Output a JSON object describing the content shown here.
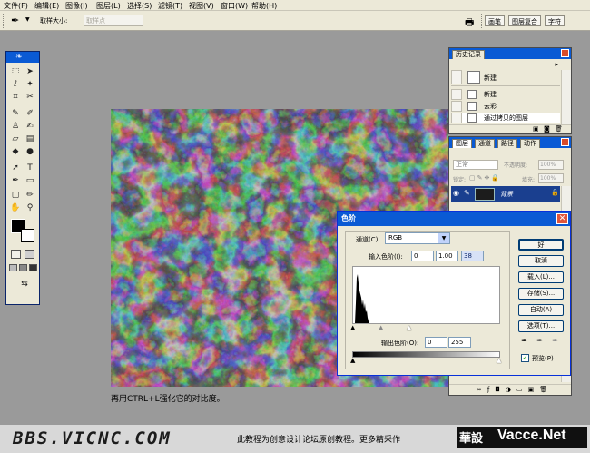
{
  "menu": [
    "文件(F)",
    "编辑(E)",
    "图像(I)",
    "图层(L)",
    "选择(S)",
    "滤镜(T)",
    "视图(V)",
    "窗口(W)",
    "帮助(H)"
  ],
  "options": {
    "sample_size_label": "取样大小:",
    "sample_size_value": "取样点",
    "well_tabs": [
      "画笔",
      "图层复合",
      "字符"
    ]
  },
  "history_panel": {
    "tab": "历史记录",
    "snapshot": "新建",
    "items": [
      "新建",
      "云彩",
      "通过拷贝的图层"
    ]
  },
  "layers_panel": {
    "tabs": [
      "图层",
      "通道",
      "路径",
      "动作"
    ],
    "blend_mode": "正常",
    "opacity_label": "不透明度:",
    "opacity_value": "100%",
    "lock_label": "锁定:",
    "fill_label": "填充:",
    "fill_value": "100%",
    "layer_name": "背景"
  },
  "levels_dialog": {
    "title": "色阶",
    "channel_label": "通道(C):",
    "channel_value": "RGB",
    "input_label": "输入色阶(I):",
    "input_black": "0",
    "input_gamma": "1.00",
    "input_white": "38",
    "output_label": "输出色阶(O):",
    "output_black": "0",
    "output_white": "255",
    "buttons": {
      "ok": "好",
      "cancel": "取消",
      "load": "载入(L)...",
      "save": "存储(S)...",
      "auto": "自动(A)",
      "options": "选项(T)..."
    },
    "preview_label": "预览(P)",
    "preview_checked": true
  },
  "caption": "再用CTRL+L强化它的对比度。",
  "footer": {
    "bbs": "BBS.VICNC.COM",
    "tutorial": "此教程为创意设计论坛原创教程。更多精采作",
    "brand_cn": "華設",
    "brand_en": "Vacce.Net"
  }
}
